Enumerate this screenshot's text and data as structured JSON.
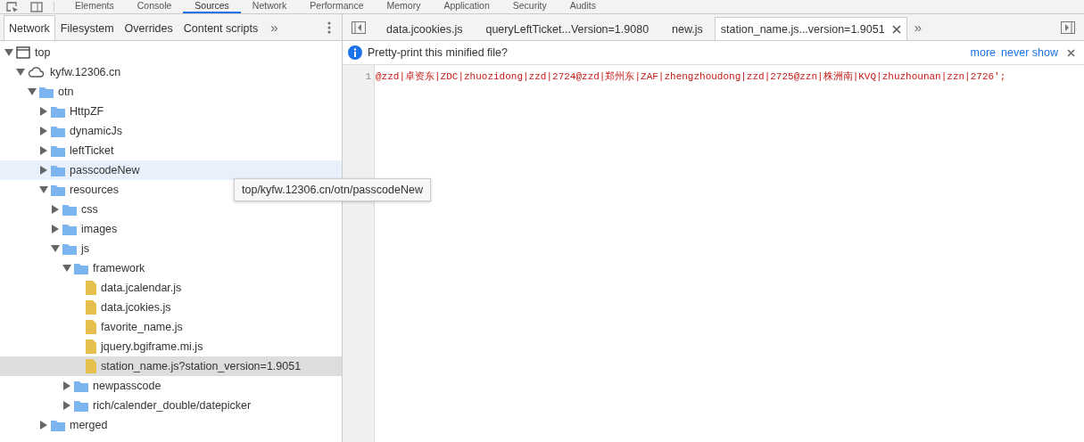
{
  "main_tabs": [
    {
      "label": "Elements",
      "selected": false
    },
    {
      "label": "Console",
      "selected": false
    },
    {
      "label": "Sources",
      "selected": true
    },
    {
      "label": "Network",
      "selected": false
    },
    {
      "label": "Performance",
      "selected": false
    },
    {
      "label": "Memory",
      "selected": false
    },
    {
      "label": "Application",
      "selected": false
    },
    {
      "label": "Security",
      "selected": false
    },
    {
      "label": "Audits",
      "selected": false
    }
  ],
  "navigator_tabs": [
    {
      "label": "Network",
      "selected": true
    },
    {
      "label": "Filesystem",
      "selected": false
    },
    {
      "label": "Overrides",
      "selected": false
    },
    {
      "label": "Content scripts",
      "selected": false
    }
  ],
  "navigator_overflow": "»",
  "tree": [
    {
      "kind": "frame",
      "label": "top",
      "expanded": true,
      "selected": false,
      "hovered": false,
      "children": [
        {
          "kind": "domain",
          "label": "kyfw.12306.cn",
          "expanded": true,
          "selected": false,
          "hovered": false,
          "children": [
            {
              "kind": "folder",
              "label": "otn",
              "expanded": true,
              "selected": false,
              "hovered": false,
              "children": [
                {
                  "kind": "folder",
                  "label": "HttpZF",
                  "expanded": false,
                  "selected": false,
                  "hovered": false
                },
                {
                  "kind": "folder",
                  "label": "dynamicJs",
                  "expanded": false,
                  "selected": false,
                  "hovered": false
                },
                {
                  "kind": "folder",
                  "label": "leftTicket",
                  "expanded": false,
                  "selected": false,
                  "hovered": false
                },
                {
                  "kind": "folder",
                  "label": "passcodeNew",
                  "expanded": false,
                  "selected": false,
                  "hovered": true
                },
                {
                  "kind": "folder",
                  "label": "resources",
                  "expanded": true,
                  "selected": false,
                  "hovered": false,
                  "children": [
                    {
                      "kind": "folder",
                      "label": "css",
                      "expanded": false,
                      "selected": false,
                      "hovered": false
                    },
                    {
                      "kind": "folder",
                      "label": "images",
                      "expanded": false,
                      "selected": false,
                      "hovered": false
                    },
                    {
                      "kind": "folder",
                      "label": "js",
                      "expanded": true,
                      "selected": false,
                      "hovered": false,
                      "children": [
                        {
                          "kind": "folder",
                          "label": "framework",
                          "expanded": true,
                          "selected": false,
                          "hovered": false,
                          "children": [
                            {
                              "kind": "file",
                              "label": "data.jcalendar.js",
                              "selected": false,
                              "hovered": false
                            },
                            {
                              "kind": "file",
                              "label": "data.jcokies.js",
                              "selected": false,
                              "hovered": false
                            },
                            {
                              "kind": "file",
                              "label": "favorite_name.js",
                              "selected": false,
                              "hovered": false
                            },
                            {
                              "kind": "file",
                              "label": "jquery.bgiframe.mi.js",
                              "selected": false,
                              "hovered": false
                            },
                            {
                              "kind": "file",
                              "label": "station_name.js?station_version=1.9051",
                              "selected": true,
                              "hovered": false
                            }
                          ]
                        },
                        {
                          "kind": "folder",
                          "label": "newpasscode",
                          "expanded": false,
                          "selected": false,
                          "hovered": false
                        },
                        {
                          "kind": "folder",
                          "label": "rich/calender_double/datepicker",
                          "expanded": false,
                          "selected": false,
                          "hovered": false
                        }
                      ]
                    }
                  ]
                },
                {
                  "kind": "folder",
                  "label": "merged",
                  "expanded": false,
                  "selected": false,
                  "hovered": false
                }
              ]
            }
          ]
        }
      ]
    }
  ],
  "tooltip": "top/kyfw.12306.cn/otn/passcodeNew",
  "editor_tabs": [
    {
      "label": "data.jcookies.js",
      "selected": false,
      "closable": false
    },
    {
      "label": "queryLeftTicket...Version=1.9080",
      "selected": false,
      "closable": false
    },
    {
      "label": "new.js",
      "selected": false,
      "closable": false
    },
    {
      "label": "station_name.js...version=1.9051",
      "selected": true,
      "closable": true
    }
  ],
  "editor_overflow": "»",
  "infobar": {
    "message": "Pretty-print this minified file?",
    "links": [
      "more",
      "never show"
    ]
  },
  "code_lines": [
    {
      "number": "1",
      "text": "@zzd|卓资东|ZDC|zhuozidong|zzd|2724@zzd|郑州东|ZAF|zhengzhoudong|zzd|2725@zzn|株洲南|KVQ|zhuzhounan|zzn|2726';"
    }
  ]
}
